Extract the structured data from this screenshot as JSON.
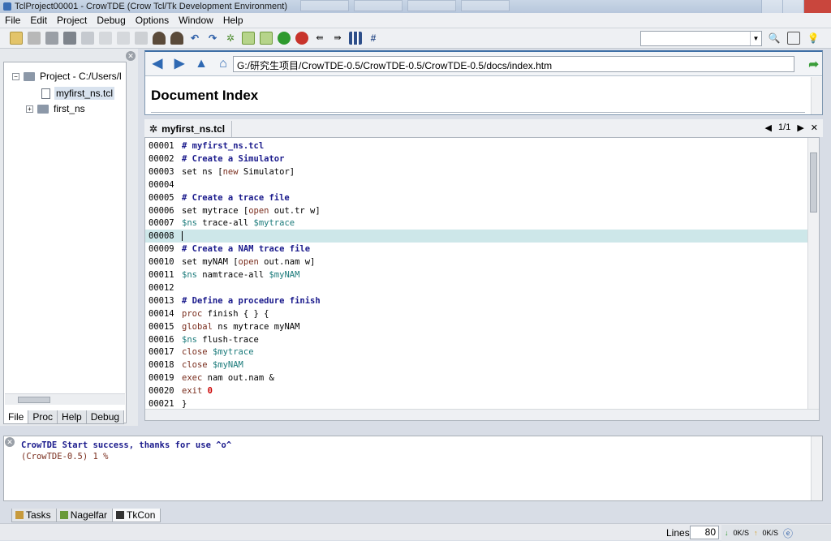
{
  "window": {
    "title": "TclProject00001 - CrowTDE (Crow Tcl/Tk Development Environment)"
  },
  "menu": [
    "File",
    "Edit",
    "Project",
    "Debug",
    "Options",
    "Window",
    "Help"
  ],
  "toolbar": {
    "icons": [
      "new-file",
      "open",
      "save",
      "save-all",
      "print",
      "cut",
      "copy",
      "paste",
      "find",
      "find-next",
      "undo",
      "redo",
      "settings",
      "add",
      "refresh",
      "run",
      "stop",
      "step",
      "step-out",
      "grid",
      "debug-tool"
    ],
    "search_value": ""
  },
  "project_panel": {
    "tree": [
      {
        "label": "Project - C:/Users/l",
        "type": "project"
      },
      {
        "label": "myfirst_ns.tcl",
        "type": "file",
        "selected": true
      },
      {
        "label": "first_ns",
        "type": "folder"
      }
    ],
    "tabs": [
      "File",
      "Proc",
      "Help",
      "Debug"
    ],
    "active_tab": "File"
  },
  "browser": {
    "url": "G:/研究生项目/CrowTDE-0.5/CrowTDE-0.5/CrowTDE-0.5/docs/index.htm",
    "heading": "Document Index"
  },
  "editor": {
    "tab_label": "myfirst_ns.tcl",
    "page_indicator": "1/1",
    "current_line": "00008",
    "lines": [
      {
        "no": "00001",
        "text": "# myfirst_ns.tcl",
        "kind": "comment"
      },
      {
        "no": "00002",
        "text": "# Create a Simulator",
        "kind": "comment"
      },
      {
        "no": "00003",
        "text": "set ns [new Simulator]",
        "kind": "plain"
      },
      {
        "no": "00004",
        "text": "",
        "kind": "plain"
      },
      {
        "no": "00005",
        "text": "# Create a trace file",
        "kind": "comment"
      },
      {
        "no": "00006",
        "text": "set mytrace [open out.tr w]",
        "kind": "plain"
      },
      {
        "no": "00007",
        "text": "$ns trace-all $mytrace",
        "kind": "var"
      },
      {
        "no": "00008",
        "text": "",
        "kind": "plain"
      },
      {
        "no": "00009",
        "text": "# Create a NAM trace file",
        "kind": "comment"
      },
      {
        "no": "00010",
        "text": "set myNAM [open out.nam w]",
        "kind": "plain"
      },
      {
        "no": "00011",
        "text": "$ns namtrace-all $myNAM",
        "kind": "var"
      },
      {
        "no": "00012",
        "text": "",
        "kind": "plain"
      },
      {
        "no": "00013",
        "text": "# Define a procedure finish",
        "kind": "comment"
      },
      {
        "no": "00014",
        "text": "proc finish { } {",
        "kind": "keyword"
      },
      {
        "no": "00015",
        "text": "global ns mytrace myNAM",
        "kind": "keyword"
      },
      {
        "no": "00016",
        "text": "$ns flush-trace",
        "kind": "var"
      },
      {
        "no": "00017",
        "text": "close $mytrace",
        "kind": "keyword"
      },
      {
        "no": "00018",
        "text": "close $myNAM",
        "kind": "keyword"
      },
      {
        "no": "00019",
        "text": "exec nam out.nam &",
        "kind": "keyword"
      },
      {
        "no": "00020",
        "text": "exit 0",
        "kind": "keyword"
      },
      {
        "no": "00021",
        "text": "}",
        "kind": "plain"
      }
    ]
  },
  "console": {
    "lines": [
      {
        "text": "CrowTDE Start success, thanks for use ^o^",
        "kind": "info"
      },
      {
        "text": "(CrowTDE-0.5) 1 %",
        "kind": "prompt"
      }
    ],
    "tabs": [
      "Tasks",
      "Nagelfar",
      "TkCon"
    ],
    "active_tab": "TkCon"
  },
  "statusbar": {
    "lines_label": "Lines",
    "lines_value": "80",
    "net_down": "0K/S",
    "net_up": "0K/S"
  },
  "colors": {
    "comment": "#1a1a8c",
    "keyword": "#7a2e1e",
    "variable": "#1a7a7a",
    "number": "#cc0000",
    "current_line": "#cde7e9"
  }
}
